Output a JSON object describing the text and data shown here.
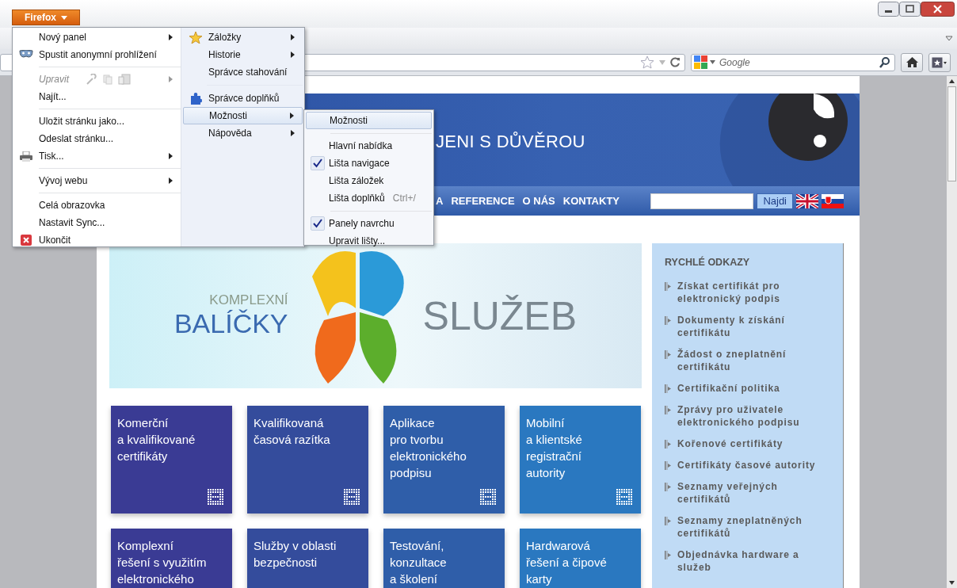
{
  "firefox_button": {
    "label": "Firefox"
  },
  "search_bar": {
    "placeholder": "Google"
  },
  "page": {
    "header_title": "JENI S DŮVĚROU",
    "nav": [
      "A",
      "REFERENCE",
      "O NÁS",
      "KONTAKTY"
    ],
    "search_button": "Najdi",
    "banner": {
      "line1": "KOMPLEXNÍ",
      "line2": "BALÍČKY",
      "line3": "SLUŽEB"
    },
    "tiles": [
      {
        "lines": [
          "Komerční",
          "a kvalifikované",
          "certifikáty"
        ],
        "color": "#3a3b94"
      },
      {
        "lines": [
          "Kvalifikovaná",
          "časová razítka"
        ],
        "color": "#344c9c"
      },
      {
        "lines": [
          "Aplikace",
          "pro tvorbu",
          "elektronického",
          "podpisu"
        ],
        "color": "#2f5ea9"
      },
      {
        "lines": [
          "Mobilní",
          "a klientské",
          "registrační",
          "autority"
        ],
        "color": "#2a78c0"
      },
      {
        "lines": [
          "Komplexní",
          "řešení s využitím",
          "elektronického"
        ],
        "color": "#3a3b94"
      },
      {
        "lines": [
          "Služby v oblasti",
          "bezpečnosti"
        ],
        "color": "#344c9c"
      },
      {
        "lines": [
          "Testování,",
          "konzultace",
          "a školení"
        ],
        "color": "#2f5ea9"
      },
      {
        "lines": [
          "Hardwarová",
          "řešení a čipové",
          "karty"
        ],
        "color": "#2a78c0"
      }
    ],
    "quick_links": {
      "title": "RYCHLÉ ODKAZY",
      "items": [
        "Získat certifikát pro elektronický podpis",
        "Dokumenty k získání certifikátu",
        "Žádost o zneplatnění certifikátu",
        "Certifikační politika",
        "Zprávy pro uživatele elektronického podpisu",
        "Kořenové certifikáty",
        "Certifikáty časové autority",
        "Seznamy veřejných certifikátů",
        "Seznamy zneplatněných certifikátů",
        "Objednávka hardware a služeb"
      ]
    }
  },
  "app_menu": {
    "left": [
      {
        "label": "Nový panel",
        "submenu": true,
        "disabled": false,
        "separator_before": false
      },
      {
        "label": "Spustit anonymní prohlížení",
        "submenu": false,
        "disabled": false,
        "separator_before": false
      },
      {
        "label": "Upravit",
        "submenu": true,
        "disabled": true,
        "separator_before": true
      },
      {
        "label": "Najít...",
        "submenu": false,
        "disabled": false,
        "separator_before": false
      },
      {
        "label": "Uložit stránku jako...",
        "submenu": false,
        "disabled": false,
        "separator_before": true
      },
      {
        "label": "Odeslat stránku...",
        "submenu": false,
        "disabled": false,
        "separator_before": false
      },
      {
        "label": "Tisk...",
        "submenu": true,
        "disabled": false,
        "separator_before": false
      },
      {
        "label": "Vývoj webu",
        "submenu": true,
        "disabled": false,
        "separator_before": true
      },
      {
        "label": "Celá obrazovka",
        "submenu": false,
        "disabled": false,
        "separator_before": true
      },
      {
        "label": "Nastavit Sync...",
        "submenu": false,
        "disabled": false,
        "separator_before": false
      },
      {
        "label": "Ukončit",
        "submenu": false,
        "disabled": false,
        "separator_before": false
      }
    ],
    "right": [
      {
        "label": "Záložky",
        "submenu": true,
        "selected": false,
        "separator_before": false
      },
      {
        "label": "Historie",
        "submenu": true,
        "selected": false,
        "separator_before": false
      },
      {
        "label": "Správce stahování",
        "submenu": false,
        "selected": false,
        "separator_before": false
      },
      {
        "label": "Správce doplňků",
        "submenu": false,
        "selected": false,
        "separator_before": true
      },
      {
        "label": "Možnosti",
        "submenu": true,
        "selected": true,
        "separator_before": false
      },
      {
        "label": "Nápověda",
        "submenu": true,
        "selected": false,
        "separator_before": false
      }
    ],
    "submenu": [
      {
        "label": "Možnosti",
        "checked": false,
        "selected": true,
        "separator_before": false
      },
      {
        "label": "Hlavní nabídka",
        "checked": false,
        "selected": false,
        "separator_before": true
      },
      {
        "label": "Lišta navigace",
        "checked": true,
        "selected": false,
        "separator_before": false
      },
      {
        "label": "Lišta záložek",
        "checked": false,
        "selected": false,
        "separator_before": false
      },
      {
        "label": "Lišta doplňků",
        "shortcut": "Ctrl+/",
        "checked": false,
        "selected": false,
        "separator_before": false
      },
      {
        "label": "Panely navrchu",
        "checked": true,
        "selected": false,
        "separator_before": true
      },
      {
        "label": "Upravit lišty...",
        "checked": false,
        "selected": false,
        "separator_before": false
      }
    ]
  }
}
